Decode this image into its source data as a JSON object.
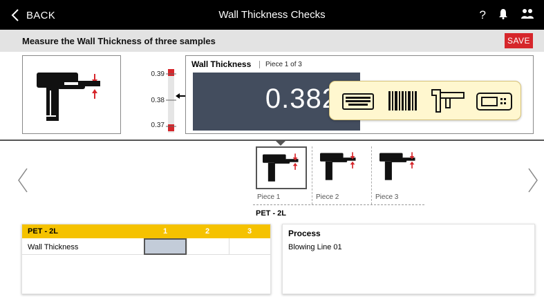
{
  "header": {
    "back_label": "BACK",
    "title": "Wall Thickness Checks",
    "icons": [
      "help-icon",
      "bell-icon",
      "users-icon"
    ]
  },
  "subheader": {
    "instruction": "Measure the Wall Thickness of three samples",
    "save_label": "SAVE"
  },
  "gauge": {
    "ticks": [
      "0.39",
      "0.38",
      "0.37"
    ],
    "current": 0.382
  },
  "measurement": {
    "title": "Wall Thickness",
    "piece_info": "Piece 1 of 3",
    "value": "0.382",
    "input_methods": [
      "keyboard-icon",
      "barcode-icon",
      "caliper-icon",
      "digital-gauge-icon"
    ]
  },
  "pieces": {
    "items": [
      {
        "label": "Piece 1",
        "selected": true
      },
      {
        "label": "Piece 2",
        "selected": false
      },
      {
        "label": "Piece 3",
        "selected": false
      }
    ],
    "product": "PET - 2L"
  },
  "table": {
    "header_label": "PET - 2L",
    "columns": [
      "1",
      "2",
      "3"
    ],
    "rows": [
      {
        "label": "Wall Thickness",
        "values": [
          "",
          "",
          ""
        ]
      }
    ]
  },
  "process": {
    "title": "Process",
    "value": "Blowing Line 01"
  },
  "colors": {
    "accent_red": "#d6262b",
    "table_header": "#f5c200",
    "display_bg": "#434d5e",
    "popup_bg": "#fff7cf"
  }
}
